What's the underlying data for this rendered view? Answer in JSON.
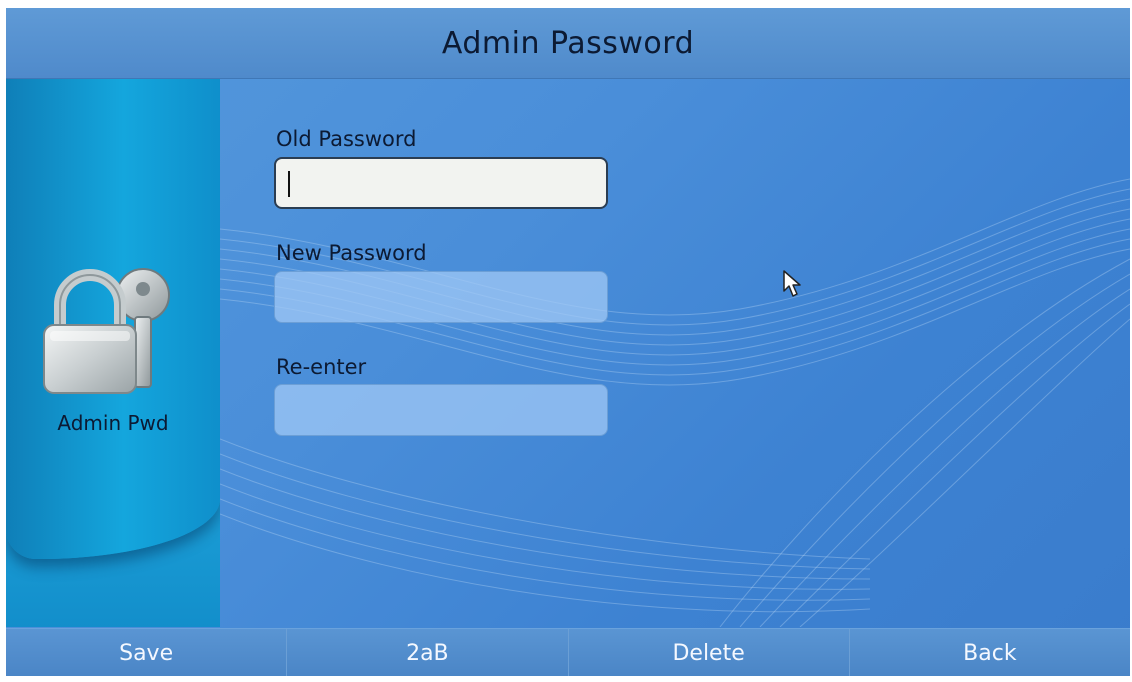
{
  "title_bar": {
    "title": "Admin Password"
  },
  "sidebar": {
    "icon": "lock-key-icon",
    "label": "Admin Pwd"
  },
  "form": {
    "old_password": {
      "label": "Old Password",
      "value": "",
      "active": true
    },
    "new_password": {
      "label": "New Password",
      "value": ""
    },
    "reenter": {
      "label": "Re-enter",
      "value": ""
    }
  },
  "softkeys": [
    {
      "label": "Save"
    },
    {
      "label": "2aB"
    },
    {
      "label": "Delete"
    },
    {
      "label": "Back"
    }
  ],
  "colors": {
    "background": "#4a8ed9",
    "sidebar": "#0e98cf",
    "softkey_bar": "#4f8acb",
    "text_dark": "#0c1a33",
    "softkey_text": "#f4f8ff"
  }
}
